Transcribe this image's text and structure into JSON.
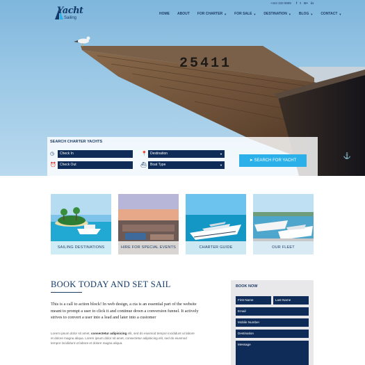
{
  "brand": {
    "logo_top": "Yacht",
    "logo_bottom": "Sailing"
  },
  "topbar": {
    "phone": "+444 333 8888",
    "social": [
      "f",
      "t",
      "G+",
      "in"
    ]
  },
  "hero": {
    "boat_number": "25411"
  },
  "nav": {
    "items": [
      {
        "label": "HOME",
        "dropdown": false
      },
      {
        "label": "ABOUT",
        "dropdown": false
      },
      {
        "label": "FOR CHARTER",
        "dropdown": true
      },
      {
        "label": "FOR SALE",
        "dropdown": true
      },
      {
        "label": "DESTINATION",
        "dropdown": true
      },
      {
        "label": "BLOG",
        "dropdown": true
      },
      {
        "label": "CONTACT",
        "dropdown": true
      }
    ]
  },
  "search": {
    "title": "SEARCH CHARTER YACHTS",
    "check_in": "Check In",
    "check_out": "Check Out",
    "destination": "Destination",
    "boat_type": "Boat Type",
    "button": "SEARCH FOR YACHT"
  },
  "cards": [
    {
      "label": "SAILING DESTINATIONS"
    },
    {
      "label": "HIRE FOR SPECIAL EVENTS"
    },
    {
      "label": "CHARTER GUIDE"
    },
    {
      "label": "OUR FLEET"
    }
  ],
  "book": {
    "heading": "BOOK TODAY AND SET SAIL",
    "cta_text": "This is a call to action block! In web design, a cta is an essential part of the website meant to prompt a user to click it and continue down a conversion funnel. It actively strives to convert a user into a lead and later into a customer",
    "lorem_a": "Lorem ipsum dolor sit amet, ",
    "lorem_bold": "consectetur adipisicing",
    "lorem_b": " elit, sed do eiusmod tempor incididunt ut labore et dolore magna aliqua. Lorem ipsum dolor sit amet, consectetur adipisicing elit, sed do eiusmod tempor incididunt ut labore et dolore magna aliqua."
  },
  "booking_form": {
    "title": "BOOK NOW",
    "first_name": "First Name",
    "last_name": "Last Name",
    "email": "Email",
    "mobile": "Mobile Number",
    "destination": "Destination",
    "message": "Message"
  },
  "colors": {
    "navy": "#0e2c57",
    "accent": "#2bb0ea",
    "panel": "#e8e8ea"
  }
}
